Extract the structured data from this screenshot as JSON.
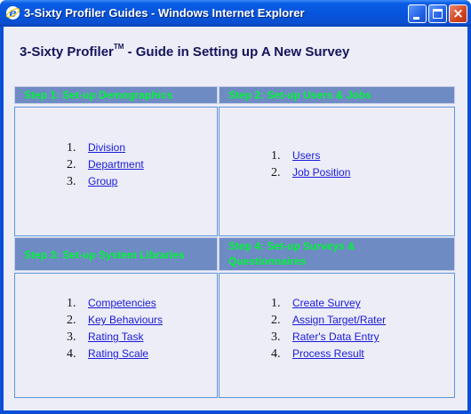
{
  "window": {
    "title": "3-Sixty Profiler Guides - Windows Internet Explorer",
    "buttons": {
      "minimize": "minimize",
      "maximize": "maximize",
      "close": "×"
    }
  },
  "page": {
    "heading_product": "3-Sixty Profiler",
    "heading_tm": "TM",
    "heading_rest": " -  Guide in Setting up A New Survey"
  },
  "steps": [
    {
      "header": "Step 1: Set-up Demographics",
      "items": [
        {
          "num": "1.",
          "label": "Division"
        },
        {
          "num": "2.",
          "label": "Department"
        },
        {
          "num": "3.",
          "label": "Group"
        }
      ]
    },
    {
      "header": "Step 2: Set-up Users & Jobs",
      "items": [
        {
          "num": "1.",
          "label": "Users"
        },
        {
          "num": "2.",
          "label": "Job Position"
        }
      ]
    },
    {
      "header": "Step 3: Set-up System Libraries",
      "items": [
        {
          "num": "1.",
          "label": "Competencies"
        },
        {
          "num": "2.",
          "label": "Key Behaviours"
        },
        {
          "num": "3.",
          "label": "Rating Task"
        },
        {
          "num": "4.",
          "label": "Rating Scale"
        }
      ]
    },
    {
      "header_line1": "Step 4: Set-up Surveys &",
      "header_line2": "Questionnaires",
      "items": [
        {
          "num": "1.",
          "label": "Create Survey"
        },
        {
          "num": "2.",
          "label": "Assign Target/Rater"
        },
        {
          "num": "3.",
          "label": "Rater's Data Entry"
        },
        {
          "num": "4.",
          "label": "Process Result"
        }
      ]
    }
  ],
  "colors": {
    "titlebar": "#0654dc",
    "page_bg": "#ecedf7",
    "step_header_bg": "#6f8bc4",
    "step_header_text": "#00f33a",
    "link": "#1a1ad8",
    "heading": "#14145a",
    "panel_border": "#5e96d8"
  },
  "icons": {
    "app": "internet-explorer-icon"
  }
}
